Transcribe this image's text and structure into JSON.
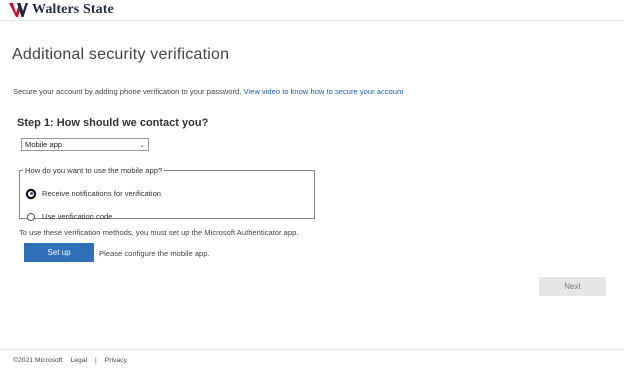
{
  "brand": {
    "name": "Walters State",
    "logo_icon": "wscc-logo-icon",
    "accent": "#c8102e"
  },
  "page": {
    "title": "Additional security verification",
    "intro_text": "Secure your account by adding phone verification to your password.",
    "intro_link": "View video to know how to secure your account"
  },
  "step1": {
    "heading": "Step 1: How should we contact you?",
    "method_selected": "Mobile app",
    "mobile_app_legend": "How do you want to use the mobile app?",
    "options": [
      {
        "label": "Receive notifications for verification",
        "checked": true
      },
      {
        "label": "Use verification code",
        "checked": false
      }
    ],
    "authenticator_note": "To use these verification methods, you must set up the Microsoft Authenticator app.",
    "setup_label": "Set up",
    "configure_note": "Please configure the mobile app."
  },
  "actions": {
    "next_label": "Next"
  },
  "footer": {
    "copyright": "©2021 Microsoft",
    "legal": "Legal",
    "separator": "|",
    "privacy": "Privacy"
  },
  "colors": {
    "primary_button": "#2f6fb7",
    "link": "#1f5ea8",
    "disabled_button": "#e6e6e6"
  }
}
